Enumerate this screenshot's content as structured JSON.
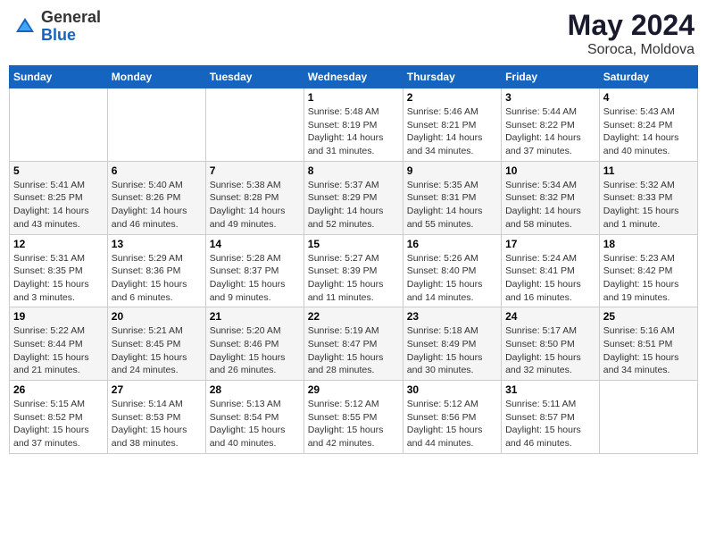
{
  "header": {
    "logo_general": "General",
    "logo_blue": "Blue",
    "title": "May 2024",
    "location": "Soroca, Moldova"
  },
  "weekdays": [
    "Sunday",
    "Monday",
    "Tuesday",
    "Wednesday",
    "Thursday",
    "Friday",
    "Saturday"
  ],
  "weeks": [
    [
      {
        "num": "",
        "info": ""
      },
      {
        "num": "",
        "info": ""
      },
      {
        "num": "",
        "info": ""
      },
      {
        "num": "1",
        "info": "Sunrise: 5:48 AM\nSunset: 8:19 PM\nDaylight: 14 hours\nand 31 minutes."
      },
      {
        "num": "2",
        "info": "Sunrise: 5:46 AM\nSunset: 8:21 PM\nDaylight: 14 hours\nand 34 minutes."
      },
      {
        "num": "3",
        "info": "Sunrise: 5:44 AM\nSunset: 8:22 PM\nDaylight: 14 hours\nand 37 minutes."
      },
      {
        "num": "4",
        "info": "Sunrise: 5:43 AM\nSunset: 8:24 PM\nDaylight: 14 hours\nand 40 minutes."
      }
    ],
    [
      {
        "num": "5",
        "info": "Sunrise: 5:41 AM\nSunset: 8:25 PM\nDaylight: 14 hours\nand 43 minutes."
      },
      {
        "num": "6",
        "info": "Sunrise: 5:40 AM\nSunset: 8:26 PM\nDaylight: 14 hours\nand 46 minutes."
      },
      {
        "num": "7",
        "info": "Sunrise: 5:38 AM\nSunset: 8:28 PM\nDaylight: 14 hours\nand 49 minutes."
      },
      {
        "num": "8",
        "info": "Sunrise: 5:37 AM\nSunset: 8:29 PM\nDaylight: 14 hours\nand 52 minutes."
      },
      {
        "num": "9",
        "info": "Sunrise: 5:35 AM\nSunset: 8:31 PM\nDaylight: 14 hours\nand 55 minutes."
      },
      {
        "num": "10",
        "info": "Sunrise: 5:34 AM\nSunset: 8:32 PM\nDaylight: 14 hours\nand 58 minutes."
      },
      {
        "num": "11",
        "info": "Sunrise: 5:32 AM\nSunset: 8:33 PM\nDaylight: 15 hours\nand 1 minute."
      }
    ],
    [
      {
        "num": "12",
        "info": "Sunrise: 5:31 AM\nSunset: 8:35 PM\nDaylight: 15 hours\nand 3 minutes."
      },
      {
        "num": "13",
        "info": "Sunrise: 5:29 AM\nSunset: 8:36 PM\nDaylight: 15 hours\nand 6 minutes."
      },
      {
        "num": "14",
        "info": "Sunrise: 5:28 AM\nSunset: 8:37 PM\nDaylight: 15 hours\nand 9 minutes."
      },
      {
        "num": "15",
        "info": "Sunrise: 5:27 AM\nSunset: 8:39 PM\nDaylight: 15 hours\nand 11 minutes."
      },
      {
        "num": "16",
        "info": "Sunrise: 5:26 AM\nSunset: 8:40 PM\nDaylight: 15 hours\nand 14 minutes."
      },
      {
        "num": "17",
        "info": "Sunrise: 5:24 AM\nSunset: 8:41 PM\nDaylight: 15 hours\nand 16 minutes."
      },
      {
        "num": "18",
        "info": "Sunrise: 5:23 AM\nSunset: 8:42 PM\nDaylight: 15 hours\nand 19 minutes."
      }
    ],
    [
      {
        "num": "19",
        "info": "Sunrise: 5:22 AM\nSunset: 8:44 PM\nDaylight: 15 hours\nand 21 minutes."
      },
      {
        "num": "20",
        "info": "Sunrise: 5:21 AM\nSunset: 8:45 PM\nDaylight: 15 hours\nand 24 minutes."
      },
      {
        "num": "21",
        "info": "Sunrise: 5:20 AM\nSunset: 8:46 PM\nDaylight: 15 hours\nand 26 minutes."
      },
      {
        "num": "22",
        "info": "Sunrise: 5:19 AM\nSunset: 8:47 PM\nDaylight: 15 hours\nand 28 minutes."
      },
      {
        "num": "23",
        "info": "Sunrise: 5:18 AM\nSunset: 8:49 PM\nDaylight: 15 hours\nand 30 minutes."
      },
      {
        "num": "24",
        "info": "Sunrise: 5:17 AM\nSunset: 8:50 PM\nDaylight: 15 hours\nand 32 minutes."
      },
      {
        "num": "25",
        "info": "Sunrise: 5:16 AM\nSunset: 8:51 PM\nDaylight: 15 hours\nand 34 minutes."
      }
    ],
    [
      {
        "num": "26",
        "info": "Sunrise: 5:15 AM\nSunset: 8:52 PM\nDaylight: 15 hours\nand 37 minutes."
      },
      {
        "num": "27",
        "info": "Sunrise: 5:14 AM\nSunset: 8:53 PM\nDaylight: 15 hours\nand 38 minutes."
      },
      {
        "num": "28",
        "info": "Sunrise: 5:13 AM\nSunset: 8:54 PM\nDaylight: 15 hours\nand 40 minutes."
      },
      {
        "num": "29",
        "info": "Sunrise: 5:12 AM\nSunset: 8:55 PM\nDaylight: 15 hours\nand 42 minutes."
      },
      {
        "num": "30",
        "info": "Sunrise: 5:12 AM\nSunset: 8:56 PM\nDaylight: 15 hours\nand 44 minutes."
      },
      {
        "num": "31",
        "info": "Sunrise: 5:11 AM\nSunset: 8:57 PM\nDaylight: 15 hours\nand 46 minutes."
      },
      {
        "num": "",
        "info": ""
      }
    ]
  ]
}
